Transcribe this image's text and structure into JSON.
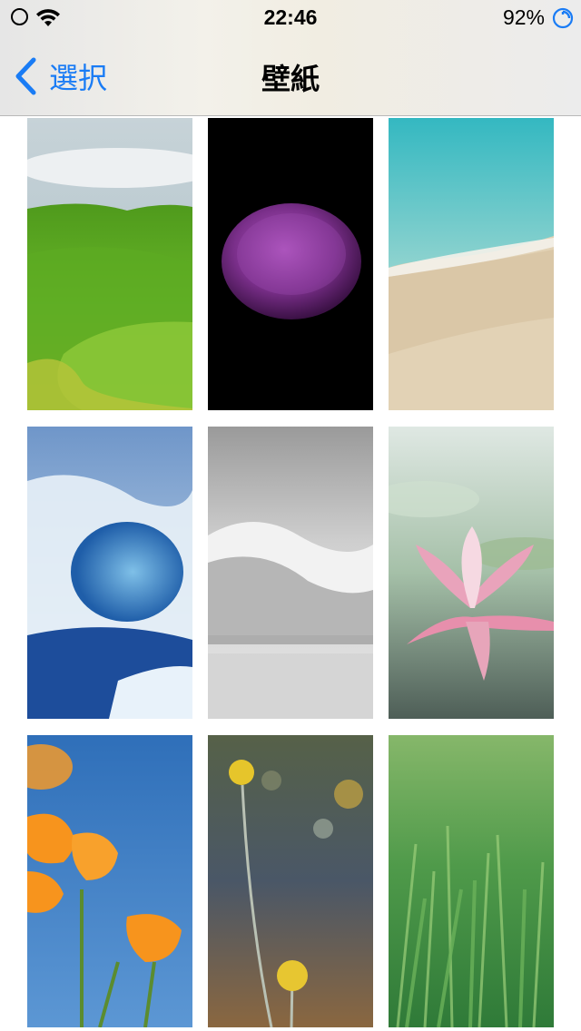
{
  "status_bar": {
    "time": "22:46",
    "battery": "92%"
  },
  "nav": {
    "back_label": "選択",
    "title": "壁紙"
  },
  "wallpapers": [
    {
      "name": "wallpaper-green-hills",
      "subject": "green-hills"
    },
    {
      "name": "wallpaper-purple-flower",
      "subject": "purple-flower-on-black"
    },
    {
      "name": "wallpaper-beach-shore",
      "subject": "turquoise-sea-beach"
    },
    {
      "name": "wallpaper-blue-wave",
      "subject": "blue-ocean-wave"
    },
    {
      "name": "wallpaper-bw-wave",
      "subject": "monochrome-wave"
    },
    {
      "name": "wallpaper-lotus",
      "subject": "pink-lotus-on-water"
    },
    {
      "name": "wallpaper-orange-poppies",
      "subject": "orange-poppies-blue-sky"
    },
    {
      "name": "wallpaper-yellow-billy-buttons",
      "subject": "yellow-flower-balls"
    },
    {
      "name": "wallpaper-dewy-grass",
      "subject": "green-grass-with-dew"
    }
  ],
  "colors": {
    "accent": "#1a7cf5"
  }
}
